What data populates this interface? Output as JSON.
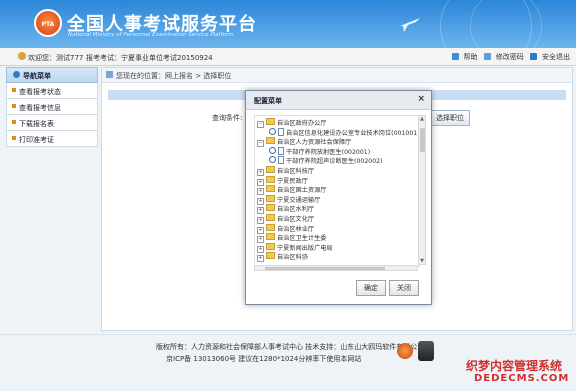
{
  "header": {
    "logo_text": "PTA",
    "title": "全国人事考试服务平台",
    "subtitle": "National Ministry of Personnel Examination Service Platform"
  },
  "userbar": {
    "welcome": "欢迎您：测试777",
    "exam": "报考考试：宁夏事业单位考试20150924",
    "help": "帮助",
    "change_password": "修改密码",
    "logout": "安全退出"
  },
  "sidebar": {
    "title": "导航菜单",
    "items": [
      {
        "label": "查看报考状态"
      },
      {
        "label": "查看报考信息"
      },
      {
        "label": "下载报名表"
      },
      {
        "label": "打印准考证"
      }
    ]
  },
  "main": {
    "breadcrumb": "您现在的位置：网上报名 > 选择职位",
    "query_label": "查询条件:",
    "select_button": "选择职位"
  },
  "modal": {
    "title": "配置菜单",
    "close": "×",
    "tree": [
      {
        "expander": "minus",
        "kind": "folder",
        "label": "自治区政府办公厅",
        "indent": 0
      },
      {
        "expander": "",
        "kind": "radio-doc",
        "label": "自治区信息化建设办公室专业技术岗位(001001)",
        "indent": 2
      },
      {
        "expander": "minus",
        "kind": "folder",
        "label": "自治区人力资源社会保障厅",
        "indent": 0
      },
      {
        "expander": "",
        "kind": "radio-doc",
        "label": "干部疗养院放射医生(002001)",
        "indent": 2
      },
      {
        "expander": "",
        "kind": "radio-doc",
        "label": "干部疗养院超声诊断医生(002002)",
        "indent": 2
      },
      {
        "expander": "plus",
        "kind": "folder",
        "label": "自治区科技厅",
        "indent": 0
      },
      {
        "expander": "plus",
        "kind": "folder",
        "label": "宁夏民政厅",
        "indent": 0
      },
      {
        "expander": "plus",
        "kind": "folder",
        "label": "自治区国土资源厅",
        "indent": 0
      },
      {
        "expander": "plus",
        "kind": "folder",
        "label": "宁夏交通运输厅",
        "indent": 0
      },
      {
        "expander": "plus",
        "kind": "folder",
        "label": "自治区水利厅",
        "indent": 0
      },
      {
        "expander": "plus",
        "kind": "folder",
        "label": "自治区文化厅",
        "indent": 0
      },
      {
        "expander": "plus",
        "kind": "folder",
        "label": "自治区林业厅",
        "indent": 0
      },
      {
        "expander": "plus",
        "kind": "folder",
        "label": "自治区卫生计生委",
        "indent": 0
      },
      {
        "expander": "plus",
        "kind": "folder",
        "label": "宁夏新闻出版广电局",
        "indent": 0
      },
      {
        "expander": "plus",
        "kind": "folder",
        "label": "自治区科协",
        "indent": 0
      }
    ],
    "confirm": "确定",
    "close_button": "关闭"
  },
  "footer": {
    "line1": "版权所有：人力资源和社会保障部人事考试中心  技术支持：山东山大鸥玛软件有限公司",
    "line2": "京ICP备 13013060号  建议在1280*1024分辨率下使用本网站",
    "watermark1": "织梦内容管理系统",
    "watermark2": "DEDECMS.COM"
  }
}
